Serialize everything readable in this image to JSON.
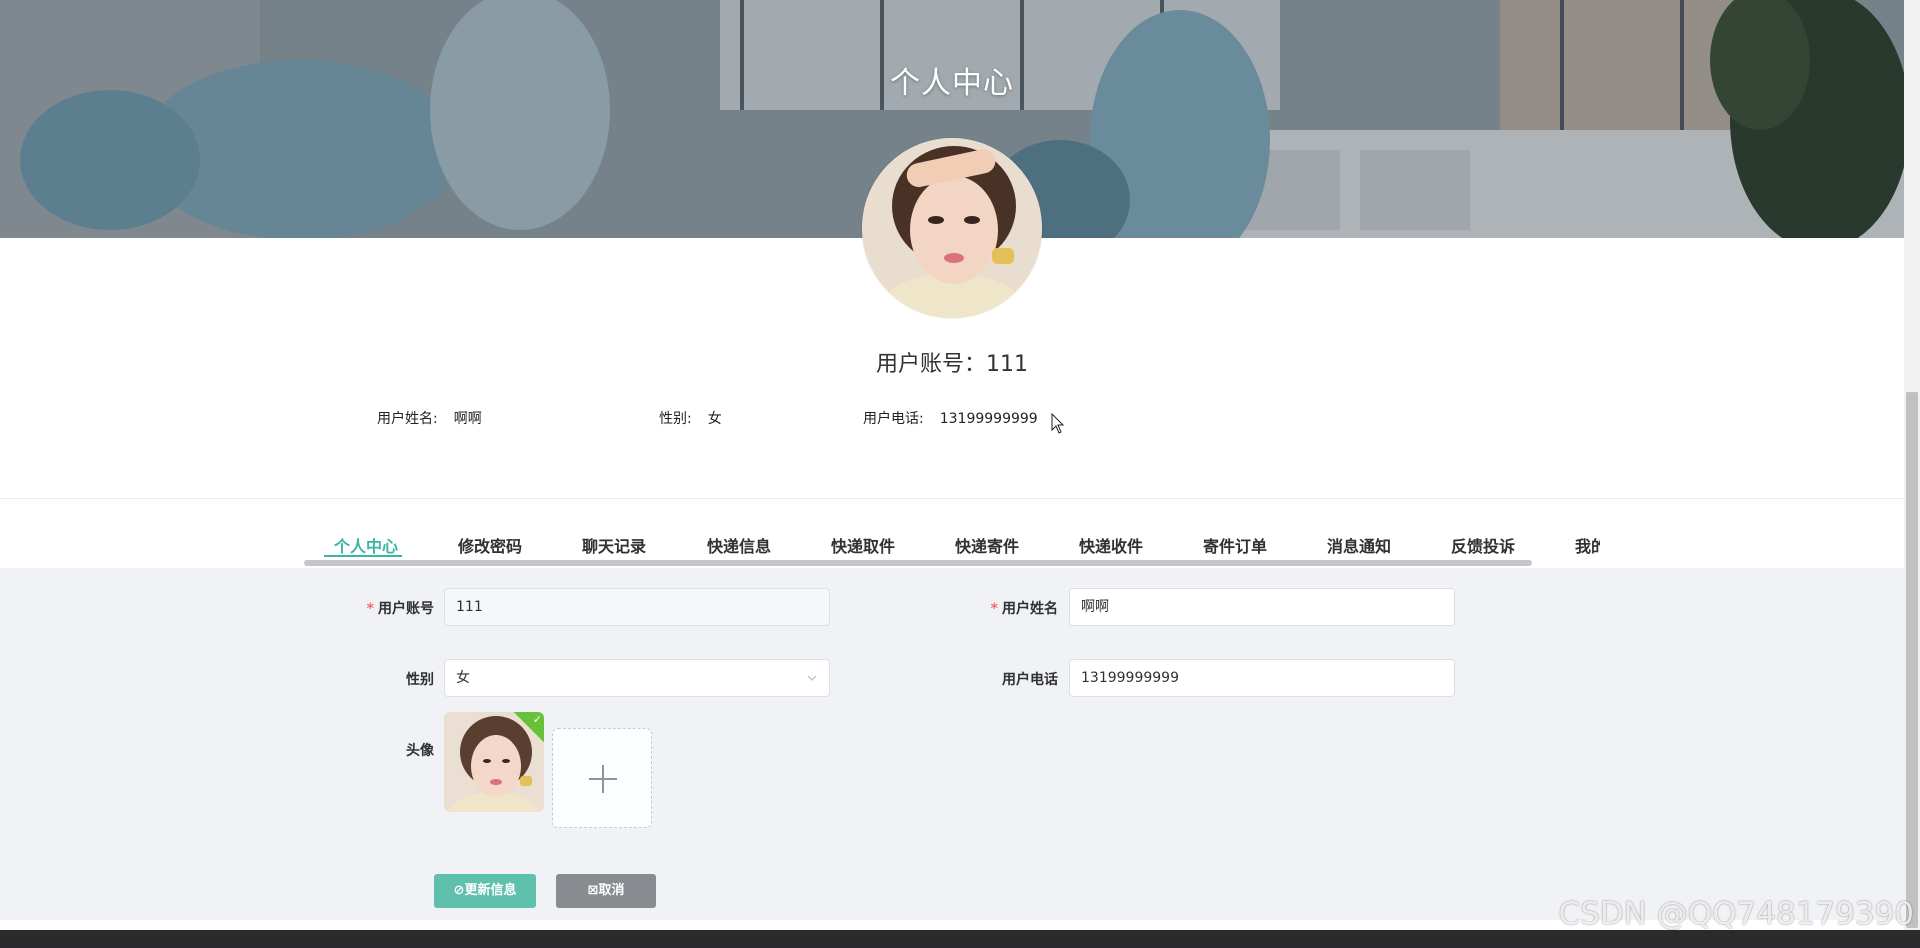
{
  "banner": {
    "title": "个人中心"
  },
  "profile": {
    "account_label": "用户账号：",
    "account_value": "111",
    "name_label": "用户姓名:",
    "name_value": "啊啊",
    "gender_label": "性别:",
    "gender_value": "女",
    "phone_label": "用户电话:",
    "phone_value": "13199999999"
  },
  "tabs": [
    {
      "label": "个人中心",
      "active": true
    },
    {
      "label": "修改密码"
    },
    {
      "label": "聊天记录"
    },
    {
      "label": "快递信息"
    },
    {
      "label": "快递取件"
    },
    {
      "label": "快递寄件"
    },
    {
      "label": "快递收件"
    },
    {
      "label": "寄件订单"
    },
    {
      "label": "消息通知"
    },
    {
      "label": "反馈投诉"
    },
    {
      "label": "我的"
    }
  ],
  "form": {
    "account": {
      "label": "用户账号",
      "value": "111"
    },
    "name": {
      "label": "用户姓名",
      "value": "啊啊"
    },
    "gender": {
      "label": "性别",
      "value": "女"
    },
    "phone": {
      "label": "用户电话",
      "value": "13199999999"
    },
    "avatar": {
      "label": "头像"
    },
    "update_button": "更新信息",
    "cancel_button": "取消"
  },
  "watermark": "CSDN @QQ748179390",
  "colors": {
    "accent": "#3ab5a6",
    "update_button": "#60c0ae",
    "cancel_button": "#888b8f",
    "upload_success": "#67c23a"
  }
}
